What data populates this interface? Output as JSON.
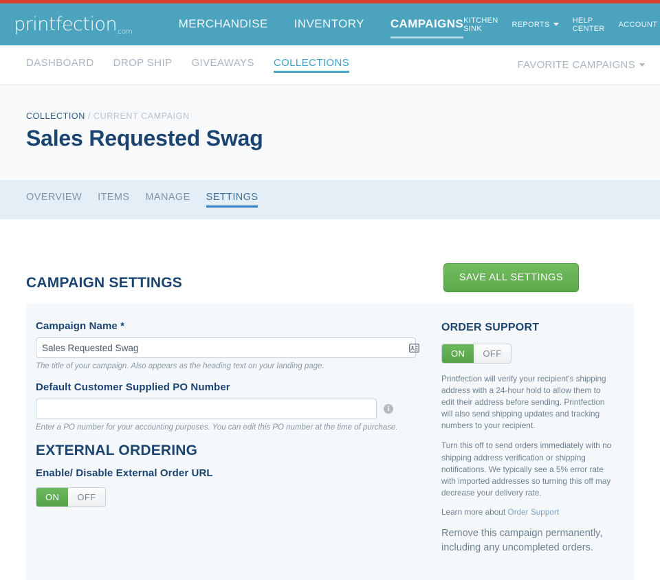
{
  "brand": {
    "logo_text": "printfection",
    "logo_suffix": ".com",
    "accent_blue": "#4ba3bd",
    "accent_red": "#d8402f",
    "accent_green": "#5ca94c",
    "heading_navy": "#1c4470"
  },
  "mainnav": {
    "items": [
      {
        "label": "MERCHANDISE",
        "active": false
      },
      {
        "label": "INVENTORY",
        "active": false
      },
      {
        "label": "CAMPAIGNS",
        "active": true
      }
    ]
  },
  "utilnav": {
    "items": [
      {
        "label": "KITCHEN SINK",
        "caret": false
      },
      {
        "label": "REPORTS",
        "caret": true
      },
      {
        "label": "HELP CENTER",
        "caret": false
      },
      {
        "label": "ACCOUNT",
        "caret": true
      }
    ]
  },
  "subnav": {
    "items": [
      {
        "label": "DASHBOARD",
        "active": false
      },
      {
        "label": "DROP SHIP",
        "active": false
      },
      {
        "label": "GIVEAWAYS",
        "active": false
      },
      {
        "label": "COLLECTIONS",
        "active": true
      }
    ],
    "favorite_label": "FAVORITE CAMPAIGNS"
  },
  "breadcrumb": {
    "root": "COLLECTION",
    "separator": "/",
    "current": "CURRENT CAMPAIGN"
  },
  "page": {
    "title": "Sales Requested Swag"
  },
  "tabs": {
    "items": [
      {
        "label": "OVERVIEW",
        "active": false
      },
      {
        "label": "ITEMS",
        "active": false
      },
      {
        "label": "MANAGE",
        "active": false
      },
      {
        "label": "SETTINGS",
        "active": true
      }
    ]
  },
  "settings": {
    "section_title": "CAMPAIGN SETTINGS",
    "save_label": "SAVE ALL SETTINGS",
    "campaign_name": {
      "label": "Campaign Name *",
      "value": "Sales Requested Swag",
      "placeholder": "",
      "helper": "The title of your campaign. Also appears as the heading text on your landing page.",
      "icon": "contact-card-icon"
    },
    "po_number": {
      "label": "Default Customer Supplied PO Number",
      "value": "",
      "placeholder": "",
      "helper": "Enter a PO number for your accounting purposes. You can edit this PO number at the time of purchase.",
      "icon": "info-icon"
    },
    "external_ordering": {
      "title": "EXTERNAL ORDERING",
      "label": "Enable/ Disable External Order URL",
      "on_label": "ON",
      "off_label": "OFF",
      "state": "ON"
    }
  },
  "order_support": {
    "title": "ORDER SUPPORT",
    "on_label": "ON",
    "off_label": "OFF",
    "state": "ON",
    "paragraph_1": "Printfection will verify your recipient's shipping address with a 24-hour hold to allow them to edit their address before sending. Printfection will also send shipping updates and tracking numbers to your recipient.",
    "paragraph_2": "Turn this off to send orders immediately with no shipping address verification or shipping notifications. We typically see a 5% error rate with imported addresses so turning this off may decrease your delivery rate.",
    "learn_prefix": "Learn more about ",
    "learn_link": "Order Support",
    "remove_text": "Remove this campaign permanently, including any uncompleted orders."
  }
}
